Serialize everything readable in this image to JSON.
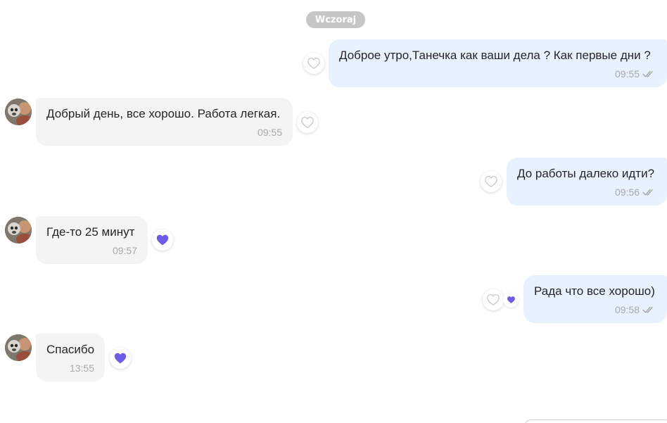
{
  "chat": {
    "date_separator": "Wczoraj",
    "messages": [
      {
        "direction": "out",
        "text": "Доброе утро,Танечка как ваши дела ? Как первые дни ?",
        "time": "09:55",
        "status": "read",
        "reaction": "none"
      },
      {
        "direction": "in",
        "text": "Добрый день, все хорошо. Работа легкая.",
        "time": "09:55",
        "reaction": "none"
      },
      {
        "direction": "out",
        "text": "До работы далеко идти?",
        "time": "09:56",
        "status": "read",
        "reaction": "none"
      },
      {
        "direction": "in",
        "text": "Где-то 25 минут",
        "time": "09:57",
        "reaction": "heart"
      },
      {
        "direction": "out",
        "text": "Рада что все хорошо)",
        "time": "09:58",
        "status": "read",
        "reaction": "heart"
      },
      {
        "direction": "in",
        "text": "Спасибо",
        "time": "13:55",
        "reaction": "heart"
      }
    ]
  },
  "icons": {
    "reaction_outline": "heart-outline-icon",
    "reaction_filled": "heart-filled-icon",
    "read_status": "double-check-icon",
    "avatar": "contact-avatar"
  },
  "colors": {
    "outgoing_bubble": "#e8f1ff",
    "incoming_bubble": "#f4f4f4",
    "date_pill": "#c6c6c6",
    "heart_filled": "#6c5ce7",
    "heart_outline": "#c9c9c9",
    "timestamp": "#a8a8a8"
  }
}
